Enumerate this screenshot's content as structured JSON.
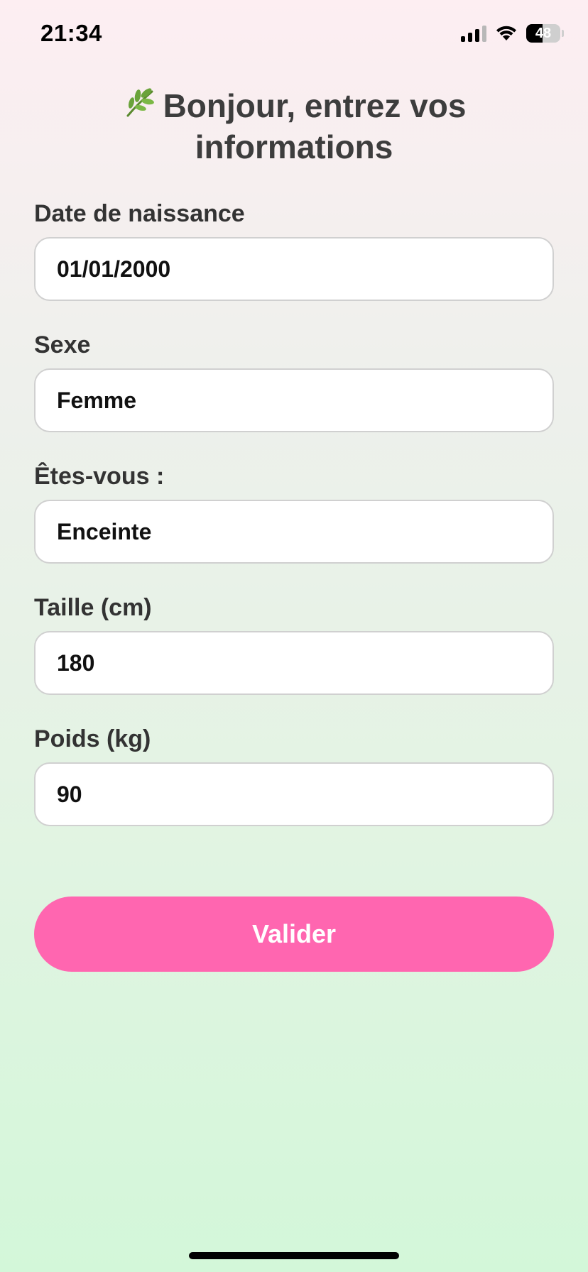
{
  "status_bar": {
    "time": "21:34",
    "battery_level": "48",
    "battery_fraction": 0.48,
    "icons": [
      "cellular-signal-icon",
      "wifi-icon",
      "battery-icon"
    ]
  },
  "page": {
    "title": "Bonjour, entrez vos informations",
    "title_icon": "herb-leaf-icon"
  },
  "form": {
    "birth_date": {
      "label": "Date de naissance",
      "value": "01/01/2000"
    },
    "sex": {
      "label": "Sexe",
      "value": "Femme"
    },
    "status": {
      "label": "Êtes-vous :",
      "value": "Enceinte"
    },
    "height": {
      "label": "Taille (cm)",
      "value": "180"
    },
    "weight": {
      "label": "Poids (kg)",
      "value": "90"
    }
  },
  "actions": {
    "submit_label": "Valider"
  },
  "colors": {
    "accent": "#ff66b0",
    "background_top": "#fdeef2",
    "background_bottom": "#d3f7d9"
  }
}
